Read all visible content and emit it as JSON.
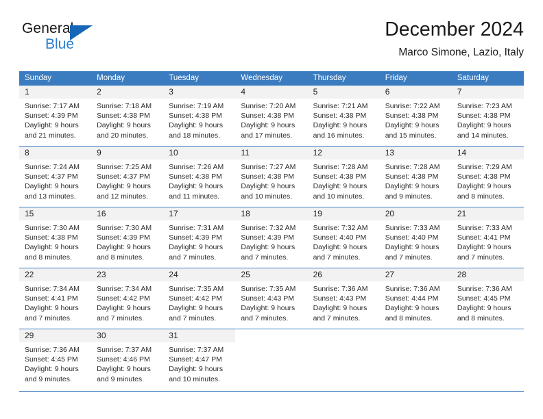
{
  "logo": {
    "word_one": "General",
    "word_two": "Blue",
    "triangle_color": "#1667b8",
    "blue_text_color": "#2a7fce"
  },
  "header": {
    "title": "December 2024",
    "subtitle": "Marco Simone, Lazio, Italy"
  },
  "theme": {
    "header_blue": "#3b7cc0",
    "day_bar_gray": "#f2f2f2",
    "text_color": "#2b2b2b"
  },
  "weekdays": [
    "Sunday",
    "Monday",
    "Tuesday",
    "Wednesday",
    "Thursday",
    "Friday",
    "Saturday"
  ],
  "weeks": [
    [
      {
        "day": "1",
        "sunrise": "Sunrise: 7:17 AM",
        "sunset": "Sunset: 4:39 PM",
        "daylight_line1": "Daylight: 9 hours",
        "daylight_line2": "and 21 minutes."
      },
      {
        "day": "2",
        "sunrise": "Sunrise: 7:18 AM",
        "sunset": "Sunset: 4:38 PM",
        "daylight_line1": "Daylight: 9 hours",
        "daylight_line2": "and 20 minutes."
      },
      {
        "day": "3",
        "sunrise": "Sunrise: 7:19 AM",
        "sunset": "Sunset: 4:38 PM",
        "daylight_line1": "Daylight: 9 hours",
        "daylight_line2": "and 18 minutes."
      },
      {
        "day": "4",
        "sunrise": "Sunrise: 7:20 AM",
        "sunset": "Sunset: 4:38 PM",
        "daylight_line1": "Daylight: 9 hours",
        "daylight_line2": "and 17 minutes."
      },
      {
        "day": "5",
        "sunrise": "Sunrise: 7:21 AM",
        "sunset": "Sunset: 4:38 PM",
        "daylight_line1": "Daylight: 9 hours",
        "daylight_line2": "and 16 minutes."
      },
      {
        "day": "6",
        "sunrise": "Sunrise: 7:22 AM",
        "sunset": "Sunset: 4:38 PM",
        "daylight_line1": "Daylight: 9 hours",
        "daylight_line2": "and 15 minutes."
      },
      {
        "day": "7",
        "sunrise": "Sunrise: 7:23 AM",
        "sunset": "Sunset: 4:38 PM",
        "daylight_line1": "Daylight: 9 hours",
        "daylight_line2": "and 14 minutes."
      }
    ],
    [
      {
        "day": "8",
        "sunrise": "Sunrise: 7:24 AM",
        "sunset": "Sunset: 4:37 PM",
        "daylight_line1": "Daylight: 9 hours",
        "daylight_line2": "and 13 minutes."
      },
      {
        "day": "9",
        "sunrise": "Sunrise: 7:25 AM",
        "sunset": "Sunset: 4:37 PM",
        "daylight_line1": "Daylight: 9 hours",
        "daylight_line2": "and 12 minutes."
      },
      {
        "day": "10",
        "sunrise": "Sunrise: 7:26 AM",
        "sunset": "Sunset: 4:38 PM",
        "daylight_line1": "Daylight: 9 hours",
        "daylight_line2": "and 11 minutes."
      },
      {
        "day": "11",
        "sunrise": "Sunrise: 7:27 AM",
        "sunset": "Sunset: 4:38 PM",
        "daylight_line1": "Daylight: 9 hours",
        "daylight_line2": "and 10 minutes."
      },
      {
        "day": "12",
        "sunrise": "Sunrise: 7:28 AM",
        "sunset": "Sunset: 4:38 PM",
        "daylight_line1": "Daylight: 9 hours",
        "daylight_line2": "and 10 minutes."
      },
      {
        "day": "13",
        "sunrise": "Sunrise: 7:28 AM",
        "sunset": "Sunset: 4:38 PM",
        "daylight_line1": "Daylight: 9 hours",
        "daylight_line2": "and 9 minutes."
      },
      {
        "day": "14",
        "sunrise": "Sunrise: 7:29 AM",
        "sunset": "Sunset: 4:38 PM",
        "daylight_line1": "Daylight: 9 hours",
        "daylight_line2": "and 8 minutes."
      }
    ],
    [
      {
        "day": "15",
        "sunrise": "Sunrise: 7:30 AM",
        "sunset": "Sunset: 4:38 PM",
        "daylight_line1": "Daylight: 9 hours",
        "daylight_line2": "and 8 minutes."
      },
      {
        "day": "16",
        "sunrise": "Sunrise: 7:30 AM",
        "sunset": "Sunset: 4:39 PM",
        "daylight_line1": "Daylight: 9 hours",
        "daylight_line2": "and 8 minutes."
      },
      {
        "day": "17",
        "sunrise": "Sunrise: 7:31 AM",
        "sunset": "Sunset: 4:39 PM",
        "daylight_line1": "Daylight: 9 hours",
        "daylight_line2": "and 7 minutes."
      },
      {
        "day": "18",
        "sunrise": "Sunrise: 7:32 AM",
        "sunset": "Sunset: 4:39 PM",
        "daylight_line1": "Daylight: 9 hours",
        "daylight_line2": "and 7 minutes."
      },
      {
        "day": "19",
        "sunrise": "Sunrise: 7:32 AM",
        "sunset": "Sunset: 4:40 PM",
        "daylight_line1": "Daylight: 9 hours",
        "daylight_line2": "and 7 minutes."
      },
      {
        "day": "20",
        "sunrise": "Sunrise: 7:33 AM",
        "sunset": "Sunset: 4:40 PM",
        "daylight_line1": "Daylight: 9 hours",
        "daylight_line2": "and 7 minutes."
      },
      {
        "day": "21",
        "sunrise": "Sunrise: 7:33 AM",
        "sunset": "Sunset: 4:41 PM",
        "daylight_line1": "Daylight: 9 hours",
        "daylight_line2": "and 7 minutes."
      }
    ],
    [
      {
        "day": "22",
        "sunrise": "Sunrise: 7:34 AM",
        "sunset": "Sunset: 4:41 PM",
        "daylight_line1": "Daylight: 9 hours",
        "daylight_line2": "and 7 minutes."
      },
      {
        "day": "23",
        "sunrise": "Sunrise: 7:34 AM",
        "sunset": "Sunset: 4:42 PM",
        "daylight_line1": "Daylight: 9 hours",
        "daylight_line2": "and 7 minutes."
      },
      {
        "day": "24",
        "sunrise": "Sunrise: 7:35 AM",
        "sunset": "Sunset: 4:42 PM",
        "daylight_line1": "Daylight: 9 hours",
        "daylight_line2": "and 7 minutes."
      },
      {
        "day": "25",
        "sunrise": "Sunrise: 7:35 AM",
        "sunset": "Sunset: 4:43 PM",
        "daylight_line1": "Daylight: 9 hours",
        "daylight_line2": "and 7 minutes."
      },
      {
        "day": "26",
        "sunrise": "Sunrise: 7:36 AM",
        "sunset": "Sunset: 4:43 PM",
        "daylight_line1": "Daylight: 9 hours",
        "daylight_line2": "and 7 minutes."
      },
      {
        "day": "27",
        "sunrise": "Sunrise: 7:36 AM",
        "sunset": "Sunset: 4:44 PM",
        "daylight_line1": "Daylight: 9 hours",
        "daylight_line2": "and 8 minutes."
      },
      {
        "day": "28",
        "sunrise": "Sunrise: 7:36 AM",
        "sunset": "Sunset: 4:45 PM",
        "daylight_line1": "Daylight: 9 hours",
        "daylight_line2": "and 8 minutes."
      }
    ],
    [
      {
        "day": "29",
        "sunrise": "Sunrise: 7:36 AM",
        "sunset": "Sunset: 4:45 PM",
        "daylight_line1": "Daylight: 9 hours",
        "daylight_line2": "and 9 minutes."
      },
      {
        "day": "30",
        "sunrise": "Sunrise: 7:37 AM",
        "sunset": "Sunset: 4:46 PM",
        "daylight_line1": "Daylight: 9 hours",
        "daylight_line2": "and 9 minutes."
      },
      {
        "day": "31",
        "sunrise": "Sunrise: 7:37 AM",
        "sunset": "Sunset: 4:47 PM",
        "daylight_line1": "Daylight: 9 hours",
        "daylight_line2": "and 10 minutes."
      },
      {
        "day": "",
        "sunrise": "",
        "sunset": "",
        "daylight_line1": "",
        "daylight_line2": ""
      },
      {
        "day": "",
        "sunrise": "",
        "sunset": "",
        "daylight_line1": "",
        "daylight_line2": ""
      },
      {
        "day": "",
        "sunrise": "",
        "sunset": "",
        "daylight_line1": "",
        "daylight_line2": ""
      },
      {
        "day": "",
        "sunrise": "",
        "sunset": "",
        "daylight_line1": "",
        "daylight_line2": ""
      }
    ]
  ]
}
